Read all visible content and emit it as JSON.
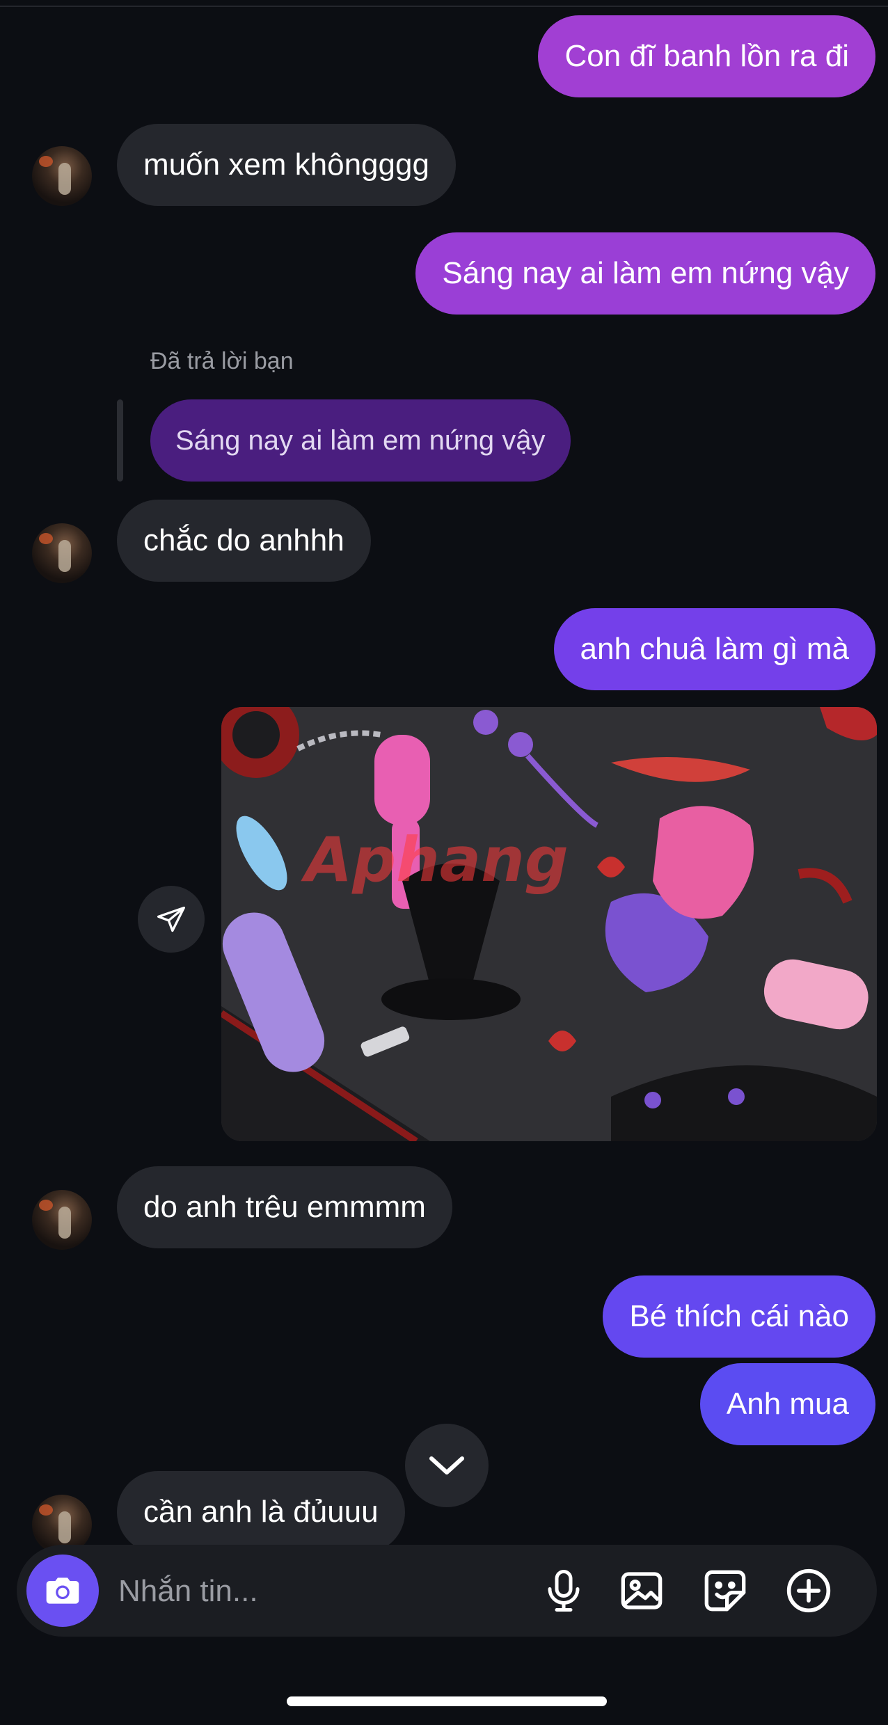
{
  "colors": {
    "background": "#0c0e13",
    "incoming_bubble": "#25272d",
    "outgoing_gradient": [
      "#a13fd3",
      "#9a3fd6",
      "#8a3fe0",
      "#7440ea",
      "#6448f0",
      "#5b4cf2"
    ],
    "reply_quote": "#4a1e7f",
    "camera_button": "#6a50f2"
  },
  "thread": {
    "messages": [
      {
        "from": "me",
        "text": "Con đĩ banh lồn ra đi"
      },
      {
        "from": "them",
        "text": "muốn xem khôngggg"
      },
      {
        "from": "me",
        "text": "Sáng nay ai làm em nứng vậy"
      },
      {
        "from": "them",
        "reply_label": "Đã trả lời bạn",
        "quoted": "Sáng nay ai làm em nứng vậy",
        "text": "chắc do anhhh"
      },
      {
        "from": "me",
        "text": "anh chuâ làm gì mà"
      },
      {
        "from": "them",
        "type": "photo",
        "watermark": "Aphang"
      },
      {
        "from": "them",
        "text": "do anh trêu emmmm"
      },
      {
        "from": "me",
        "text": "Bé thích cái nào"
      },
      {
        "from": "me",
        "text": "Anh mua"
      },
      {
        "from": "them",
        "text": "cần anh là đủuuu"
      }
    ]
  },
  "icons": {
    "avatar": "contact-avatar",
    "share": "paper-plane-icon",
    "scroll": "chevron-down-icon",
    "camera": "camera-icon",
    "microphone": "microphone-icon",
    "gallery": "image-icon",
    "sticker": "sticker-icon",
    "more": "plus-circle-icon"
  },
  "composer": {
    "placeholder": "Nhắn tin..."
  }
}
